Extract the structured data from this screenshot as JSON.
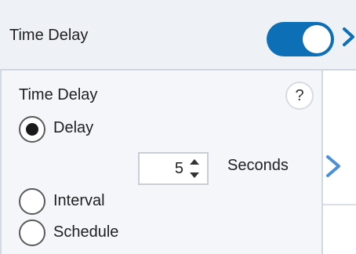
{
  "header": {
    "title": "Time Delay",
    "toggle_on": true,
    "accent_color": "#0d6fb6",
    "chevron_icon": "chevron-right-icon"
  },
  "panel": {
    "title": "Time Delay",
    "help_label": "?",
    "options": [
      {
        "label": "Delay",
        "selected": true
      },
      {
        "label": "Interval",
        "selected": false
      },
      {
        "label": "Schedule",
        "selected": false
      }
    ],
    "delay_value": "5",
    "delay_unit": "Seconds"
  },
  "side": {
    "chevron_icon": "chevron-right-icon"
  }
}
